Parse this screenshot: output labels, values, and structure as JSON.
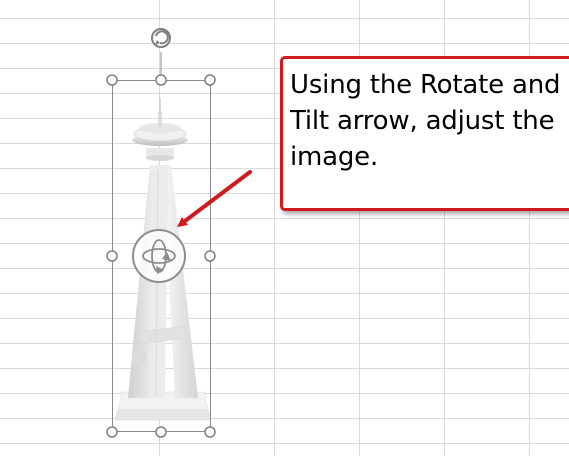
{
  "callout": {
    "text": "Using the Rotate and\nTilt arrow, adjust the\nimage."
  },
  "colors": {
    "callout_border": "#d11a1f",
    "arrow": "#d11a1f",
    "gridline": "#dadada",
    "handle_stroke": "#7f7f7f",
    "selection_border": "#8a8a8a"
  },
  "icons": {
    "rotate_handle": "rotate-icon",
    "tilt_control": "rotate-tilt-icon"
  },
  "model": {
    "name": "Space Needle 3D model"
  }
}
